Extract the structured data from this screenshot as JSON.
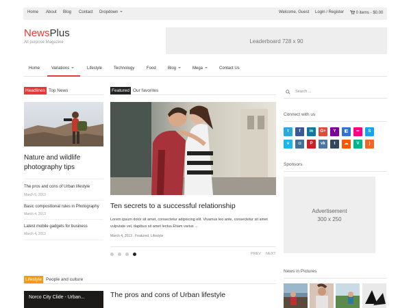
{
  "topbar": {
    "links": [
      "Home",
      "About",
      "Blog",
      "Contact"
    ],
    "dropdown_label": "Dropdown",
    "welcome": "Welcome, Guest",
    "login": "Login / Register",
    "cart": "0 items - $0.00"
  },
  "brand": {
    "name_part1": "News",
    "name_part2": "Plus",
    "tagline": "All purpose Magazine",
    "accent_color": "#e53935"
  },
  "leaderboard": {
    "label": "Leaderboard 728 x 90"
  },
  "nav": {
    "items": [
      {
        "label": "Home",
        "dropdown": false,
        "active": false
      },
      {
        "label": "Variations",
        "dropdown": true,
        "active": true
      },
      {
        "label": "Lifestyle",
        "dropdown": false,
        "active": false
      },
      {
        "label": "Technology",
        "dropdown": false,
        "active": false
      },
      {
        "label": "Food",
        "dropdown": false,
        "active": false
      },
      {
        "label": "Blog",
        "dropdown": true,
        "active": false
      },
      {
        "label": "Mega",
        "dropdown": true,
        "active": false
      },
      {
        "label": "Contact Us",
        "dropdown": false,
        "active": false
      }
    ]
  },
  "headlines": {
    "label": "Headlines",
    "subtitle": "Top News",
    "label_color": "#e53935",
    "main_title": "Nature and wildlife photography tips",
    "items": [
      {
        "title": "The pros and cons of Urban lifestyle",
        "date": "March 5, 2013"
      },
      {
        "title": "Basic compositional rules in Photography",
        "date": "March 4, 2013"
      },
      {
        "title": "Latest mobile gadgets for business",
        "date": "March 4, 2013"
      }
    ]
  },
  "featured": {
    "label": "Featured",
    "subtitle": "Our favorites",
    "label_color": "#222222",
    "title": "Ten secrets to a successful relationship",
    "excerpt": "Lorem ipsum dolor sit amet, consectetur adipiscing elit. Vivamus leo ante, consectetur sit amet vulputate vel, dapibus sit amet lectus.Etiam varius ...",
    "meta": "March 4, 2013 . Featured, Lifestyle",
    "slide_count": 4,
    "active_slide": 4,
    "prev": "PREV",
    "next": "NEXT"
  },
  "sidebar": {
    "search_placeholder": "Search ...",
    "connect_heading": "Connect with us",
    "social_icons": [
      {
        "name": "twitter-icon",
        "glyph": "t",
        "color": "#2aa9e0"
      },
      {
        "name": "facebook-icon",
        "glyph": "f",
        "color": "#3b5998"
      },
      {
        "name": "linkedin-icon",
        "glyph": "in",
        "color": "#0e76a8"
      },
      {
        "name": "googleplus-icon",
        "glyph": "G+",
        "color": "#dd4b39"
      },
      {
        "name": "yahoo-icon",
        "glyph": "Y",
        "color": "#7b0099"
      },
      {
        "name": "delicious-icon",
        "glyph": "◧",
        "color": "#3274d1"
      },
      {
        "name": "flickr-icon",
        "glyph": "••",
        "color": "#ff0084"
      },
      {
        "name": "skype-icon",
        "glyph": "S",
        "color": "#12a5f4"
      },
      {
        "name": "vimeo-icon",
        "glyph": "v",
        "color": "#1ab7ea"
      },
      {
        "name": "instagram-icon",
        "glyph": "◘",
        "color": "#3f729b"
      },
      {
        "name": "pinterest-icon",
        "glyph": "P",
        "color": "#cb2027"
      },
      {
        "name": "vk-icon",
        "glyph": "vk",
        "color": "#4c75a3"
      },
      {
        "name": "tumblr-icon",
        "glyph": "t",
        "color": "#35465c"
      },
      {
        "name": "soundcloud-icon",
        "glyph": "☁",
        "color": "#ff5500"
      },
      {
        "name": "vine-icon",
        "glyph": "V",
        "color": "#00b489"
      },
      {
        "name": "rss-icon",
        "glyph": ")",
        "color": "#f26522"
      }
    ],
    "sponsors_heading": "Sponsors",
    "ad_line1": "Advertisement",
    "ad_line2": "300 x 250",
    "pictures_heading": "News in Pictures"
  },
  "lifestyle": {
    "label": "Lifestyle",
    "subtitle": "People and culture",
    "label_color": "#f39c12",
    "image_title": "Norco City Clide - Urban...",
    "title": "The pros and cons of Urban lifestyle"
  }
}
